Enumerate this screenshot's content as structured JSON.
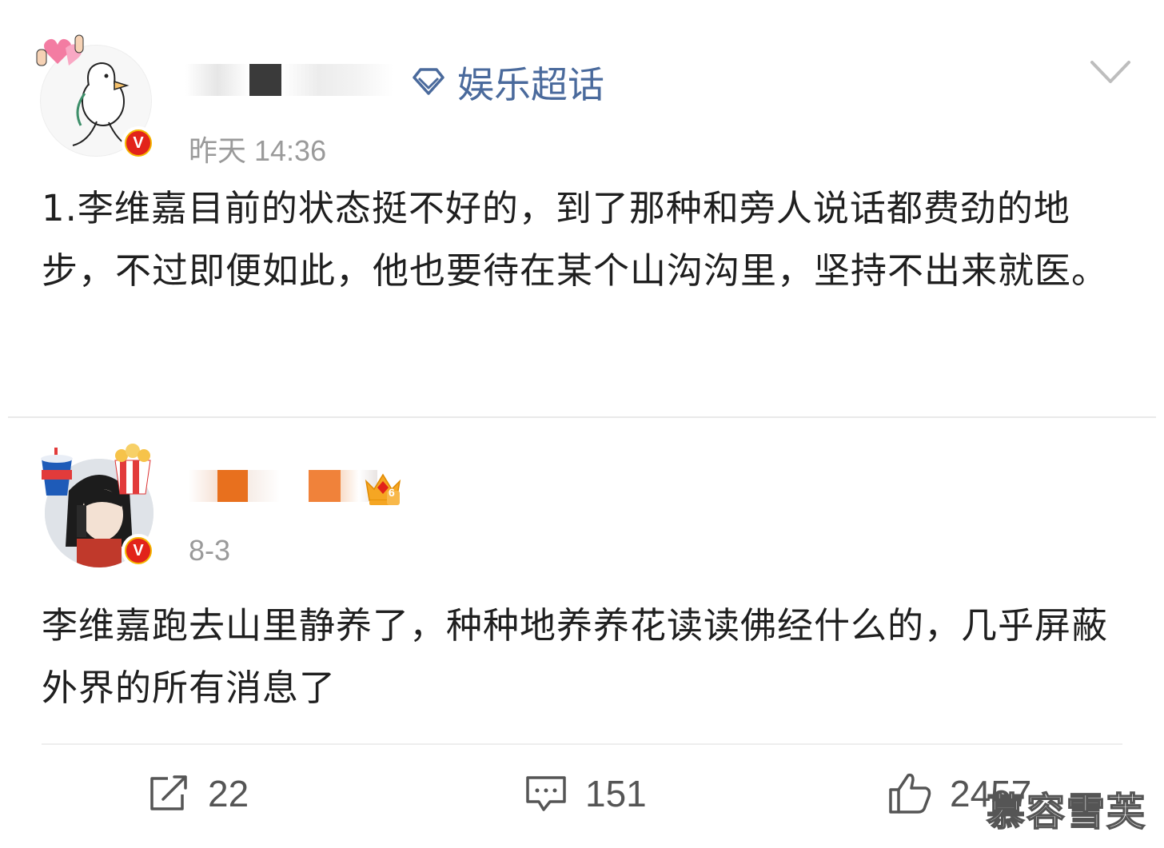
{
  "post1": {
    "supertopic_label": "娱乐超话",
    "time": "昨天 14:36",
    "text": "1.李维嘉目前的状态挺不好的，到了那种和旁人说话都费劲的地步，不过即便如此，他也要待在某个山沟沟里，坚持不出来就医。"
  },
  "post2": {
    "time": "8-3",
    "text": "李维嘉跑去山里静养了，种种地养养花读读佛经什么的，几乎屏蔽外界的所有消息了",
    "level_badge": "6"
  },
  "actions": {
    "repost_count": "22",
    "comment_count": "151",
    "like_count": "2457"
  },
  "watermark": "慕容雪芙",
  "colors": {
    "supertopic": "#4a6a9c",
    "verified_outer": "#f4b400",
    "verified_inner": "#e2231a",
    "meta_gray": "#9a9a9a"
  }
}
